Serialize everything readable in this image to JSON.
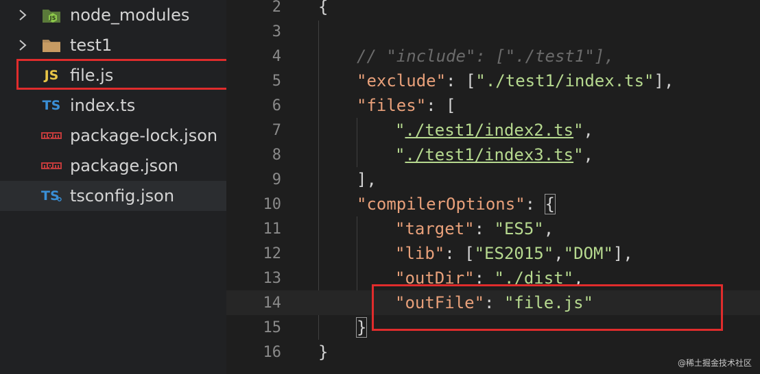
{
  "explorer": {
    "items": [
      {
        "label": "node_modules",
        "icon": "node-folder-icon",
        "collapsible": true
      },
      {
        "label": "test1",
        "icon": "folder-icon",
        "collapsible": true
      },
      {
        "label": "file.js",
        "icon_text": "JS",
        "icon": "javascript-file-icon"
      },
      {
        "label": "index.ts",
        "icon_text": "TS",
        "icon": "typescript-file-icon"
      },
      {
        "label": "package-lock.json",
        "icon": "npm-icon"
      },
      {
        "label": "package.json",
        "icon": "npm-icon"
      },
      {
        "label": "tsconfig.json",
        "icon_text": "TS",
        "icon": "tsconfig-file-icon",
        "selected": true
      }
    ]
  },
  "editor": {
    "lines": [
      {
        "n": "2"
      },
      {
        "n": "3"
      },
      {
        "n": "4"
      },
      {
        "n": "5"
      },
      {
        "n": "6"
      },
      {
        "n": "7"
      },
      {
        "n": "8"
      },
      {
        "n": "9"
      },
      {
        "n": "10"
      },
      {
        "n": "11"
      },
      {
        "n": "12"
      },
      {
        "n": "13"
      },
      {
        "n": "14"
      },
      {
        "n": "15"
      },
      {
        "n": "16"
      }
    ],
    "code": {
      "l2_open": "{",
      "l4_comment": "// \"include\": [\"./test1\"],",
      "l5_key": "\"exclude\"",
      "l5_colon": ": [",
      "l5_val": "\"./test1/index.ts\"",
      "l5_end": "],",
      "l6_key": "\"files\"",
      "l6_rest": ": [",
      "l7_q": "\"",
      "l7_val": "./test1/index2.ts",
      "l7_end": "\",",
      "l8_q": "\"",
      "l8_val": "./test1/index3.ts",
      "l8_end": "\",",
      "l9": "],",
      "l10_key": "\"compilerOptions\"",
      "l10_colon": ": ",
      "l10_brace": "{",
      "l11_key": "\"target\"",
      "l11_colon": ": ",
      "l11_val": "\"ES5\"",
      "l11_end": ",",
      "l12_key": "\"lib\"",
      "l12_colon": ": [",
      "l12_v1": "\"ES2015\"",
      "l12_comma": ",",
      "l12_v2": "\"DOM\"",
      "l12_end": "],",
      "l13_key": "\"outDir\"",
      "l13_colon": ": ",
      "l13_val": "\"./dist\"",
      "l13_end": ",",
      "l14_key": "\"outFile\"",
      "l14_colon": ": ",
      "l14_val": "\"file.js\"",
      "l15": "}",
      "l16": "}"
    }
  },
  "watermark": "@稀土掘金技术社区",
  "colors": {
    "highlight_box": "#e02c2c",
    "key": "#e8a07a",
    "string": "#b6d98f"
  }
}
